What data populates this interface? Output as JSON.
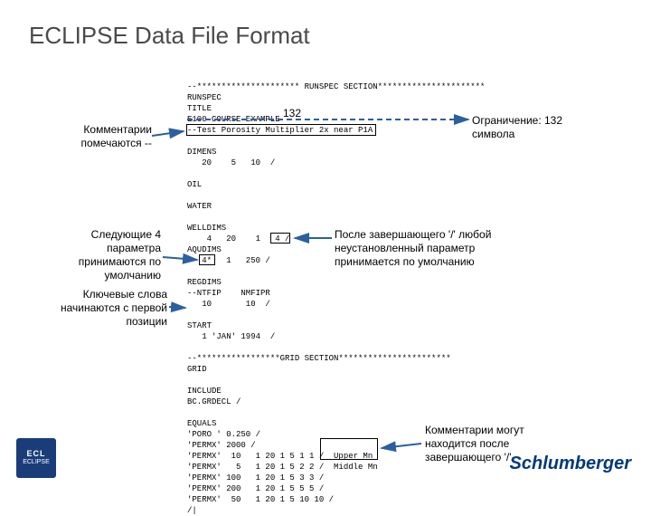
{
  "title": "ECLIPSE Data File Format",
  "label132": "132",
  "annotations": {
    "left1": "Комментарии\nпомечаются --",
    "left2": "Следующие 4\nпараметра\nпринимаются по\nумолчанию",
    "left3": "Ключевые слова\nначинаются с первой\nпозиции",
    "right1": "Ограничение: 132\nсимвола",
    "right2": "После завершающего '/' любой\nнеустановленный параметр\nпринимается по умолчанию",
    "right3": "Комментарии могут\nнаходится после\nзавершающего '/'"
  },
  "code": "--********************* RUNSPEC SECTION**********************\nRUNSPEC\nTITLE\nE100 COURSE EXAMPLE\n--Test Porosity Multiplier 2x near P1A\n\nDIMENS\n   20    5   10  /\n\nOIL\n\nWATER\n\nWELLDIMS\n    4   20    1   4 /\nAQUDIMS\n   4*   1   250 /\n\nREGDIMS\n--NTFIP    NMFIPR\n   10       10  /\n\nSTART\n   1 'JAN' 1994  /\n\n--*****************GRID SECTION***********************\nGRID\n\nINCLUDE\nBC.GRDECL /\n\nEQUALS\n'PORO ' 0.250 /\n'PERMX' 2000 /\n'PERMX'  10   1 20 1 5 1 1 /  Upper Mn\n'PERMX'   5   1 20 1 5 2 2 /  Middle Mn\n'PERMX' 100   1 20 1 5 3 3 /\n'PERMX' 200   1 20 1 5 5 5 /\n'PERMX'  50   1 20 1 5 10 10 /\n/|",
  "logos": {
    "ecl_top": "ECL",
    "ecl_bot": "ECLIPSE",
    "slb": "Schlumberger"
  }
}
